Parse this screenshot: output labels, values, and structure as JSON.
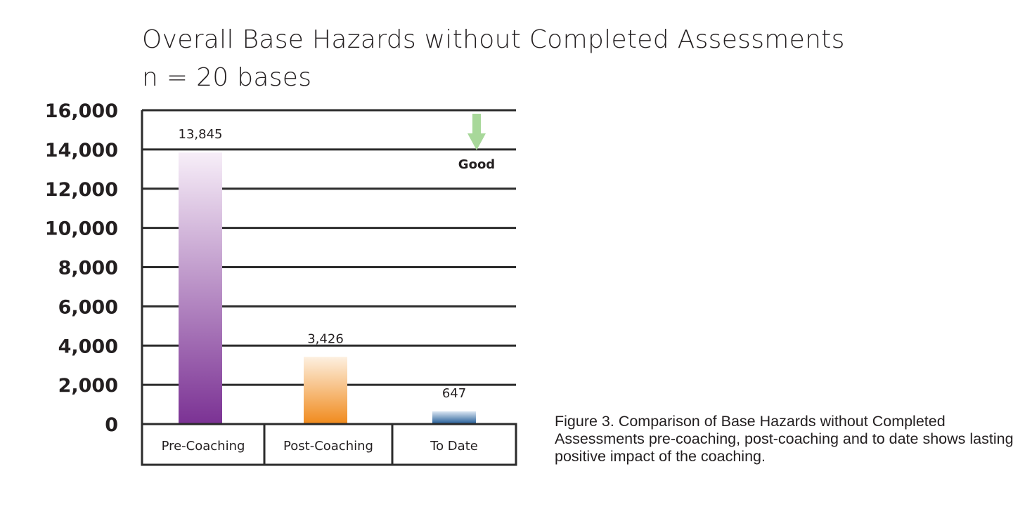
{
  "chart_data": {
    "type": "bar",
    "title": "Overall Base Hazards without Completed Assessments",
    "subtitle": "n = 20 bases",
    "categories": [
      "Pre-Coaching",
      "Post-Coaching",
      "To Date"
    ],
    "values": [
      13845,
      3426,
      647
    ],
    "value_labels": [
      "13,845",
      "3,426",
      "647"
    ],
    "xlabel": "",
    "ylabel": "",
    "ylim": [
      0,
      16000
    ],
    "yticks": [
      0,
      2000,
      4000,
      6000,
      8000,
      10000,
      12000,
      14000,
      16000
    ],
    "ytick_labels": [
      "0",
      "2,000",
      "4,000",
      "6,000",
      "8,000",
      "10,000",
      "12,000",
      "14,000",
      "16,000"
    ],
    "grid": true,
    "bar_colors": [
      {
        "top": "#f7eef8",
        "bottom": "#7b3294"
      },
      {
        "top": "#fdf0e0",
        "bottom": "#f08a1c"
      },
      {
        "top": "#dbe6f2",
        "bottom": "#1f5a96"
      }
    ],
    "annotation": {
      "label": "Good",
      "icon": "down-arrow-icon",
      "color": "#a8d89a",
      "position": "top-right"
    }
  },
  "caption": "Figure 3. Comparison of Base Hazards without Completed Assessments pre-coaching, post-coaching and to date shows lasting positive impact of the coaching."
}
